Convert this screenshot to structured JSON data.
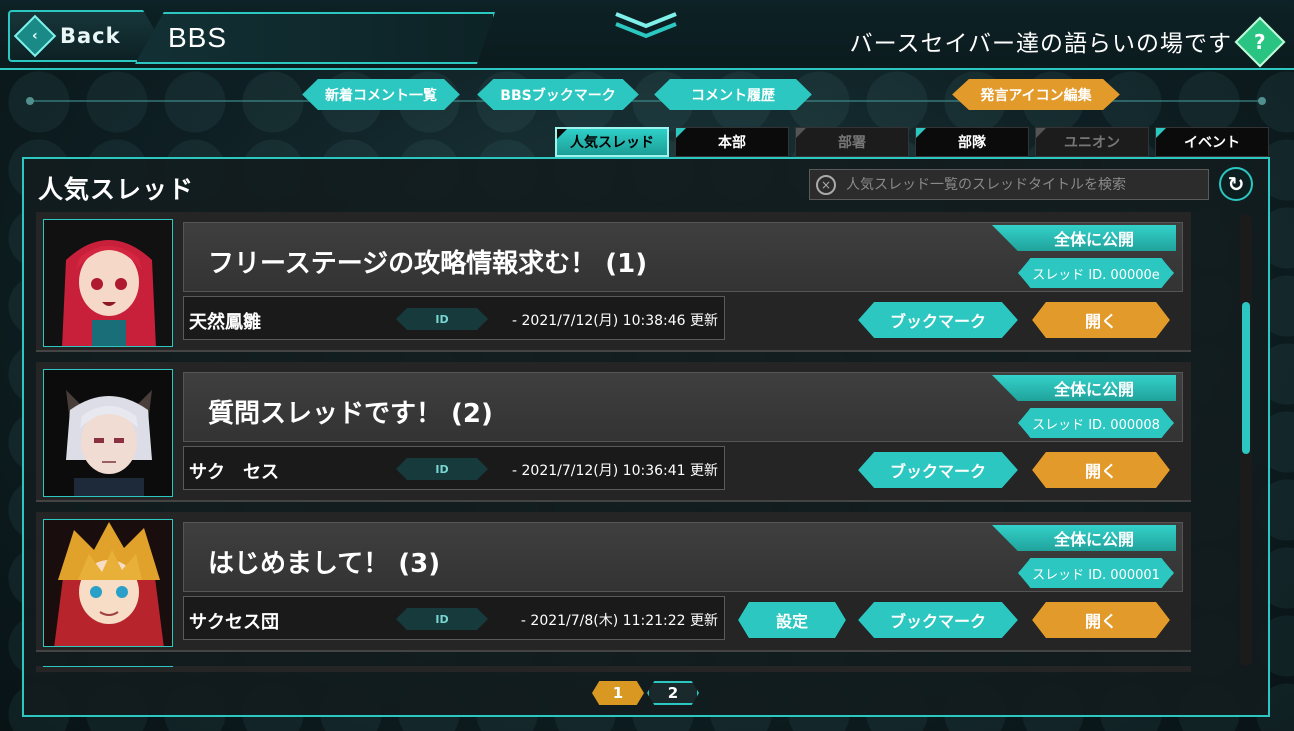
{
  "header": {
    "back_label": "Back",
    "title": "BBS",
    "subtitle": "バースセイバー達の語らいの場です",
    "help_label": "?"
  },
  "subnav": [
    {
      "label": "新着コメント一覧",
      "accent": "#2bc7c0"
    },
    {
      "label": "BBSブックマーク",
      "accent": "#2bc7c0"
    },
    {
      "label": "コメント履歴",
      "accent": "#2bc7c0"
    },
    {
      "label": "発言アイコン編集",
      "accent": "#e29a2a"
    }
  ],
  "tabs": [
    {
      "label": "人気スレッド",
      "state": "active"
    },
    {
      "label": "本部",
      "state": "enabled"
    },
    {
      "label": "部署",
      "state": "disabled"
    },
    {
      "label": "部隊",
      "state": "enabled"
    },
    {
      "label": "ユニオン",
      "state": "disabled"
    },
    {
      "label": "イベント",
      "state": "enabled"
    }
  ],
  "panel": {
    "title": "人気スレッド",
    "search_placeholder": "人気スレッド一覧のスレッドタイトルを検索"
  },
  "threads": [
    {
      "title": "フリーステージの攻略情報求む！ (1)",
      "visibility": "全体に公開",
      "thread_id": "スレッド ID. 00000e",
      "author": "天然鳳雛",
      "id_tag": "ID",
      "updated": "- 2021/7/12(月) 10:38:46 更新",
      "bookmark_label": "ブックマーク",
      "open_label": "開く"
    },
    {
      "title": "質問スレッドです！ (2)",
      "visibility": "全体に公開",
      "thread_id": "スレッド ID. 000008",
      "author": "サク　セス",
      "id_tag": "ID",
      "updated": "- 2021/7/12(月) 10:36:41 更新",
      "bookmark_label": "ブックマーク",
      "open_label": "開く"
    },
    {
      "title": "はじめまして！ (3)",
      "visibility": "全体に公開",
      "thread_id": "スレッド ID. 000001",
      "author": "サクセス団",
      "id_tag": "ID",
      "updated": "- 2021/7/8(木) 11:21:22 更新",
      "settings_label": "設定",
      "bookmark_label": "ブックマーク",
      "open_label": "開く"
    }
  ],
  "pagination": {
    "pages": [
      "1",
      "2"
    ],
    "current": "1"
  },
  "colors": {
    "accent": "#2bc7c0",
    "open_accent": "#e29a2a",
    "page_current": "#d99822"
  }
}
